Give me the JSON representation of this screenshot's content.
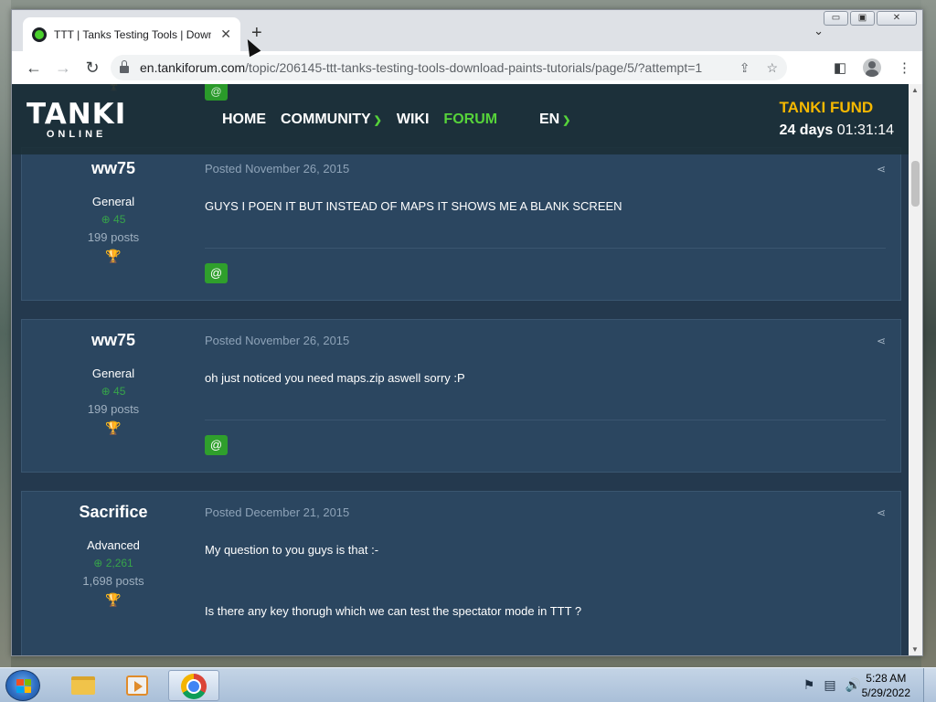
{
  "browser": {
    "tab_title": "TTT | Tanks Testing Tools | Downl",
    "tab_close": "✕",
    "new_tab": "+",
    "tab_dropdown": "⌄",
    "url_domain": "en.tankiforum.com",
    "url_path": "/topic/206145-ttt-tanks-testing-tools-download-paints-tutorials/page/5/?attempt=1",
    "window_controls": [
      "▭",
      "▣",
      "✕"
    ]
  },
  "site": {
    "logo": "TANKI",
    "logo_sub": "ONLINE",
    "nav": {
      "home": "HOME",
      "community": "COMMUNITY",
      "wiki": "WIKI",
      "forum": "FORUM",
      "lang": "EN"
    },
    "fund": {
      "title": "TANKI FUND",
      "days": "24 days",
      "time": "01:31:14"
    }
  },
  "posts": [
    {
      "author": "ww75",
      "rank": "General",
      "reputation": "45",
      "posts": "199 posts",
      "date": "Posted November 26, 2015",
      "text": [
        "GUYS I POEN IT BUT INSTEAD OF MAPS IT SHOWS ME A BLANK SCREEN"
      ]
    },
    {
      "author": "ww75",
      "rank": "General",
      "reputation": "45",
      "posts": "199 posts",
      "date": "Posted November 26, 2015",
      "text": [
        "oh just noticed you need maps.zip aswell sorry :P"
      ]
    },
    {
      "author": "Sacrifice",
      "rank": "Advanced",
      "reputation": "2,261",
      "posts": "1,698 posts",
      "date": "Posted December 21, 2015",
      "text": [
        "My question to you guys is that :-",
        "Is there any key thorugh which we can test the spectator mode in TTT ?"
      ]
    }
  ],
  "mention_label": "@",
  "taskbar": {
    "time": "5:28 AM",
    "date": "5/29/2022"
  }
}
